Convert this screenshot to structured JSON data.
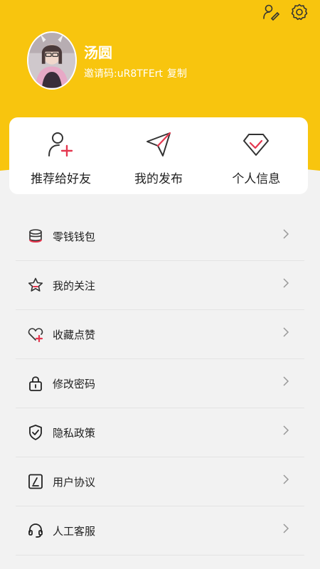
{
  "header": {
    "accent_color": "#f8c50e",
    "icons": [
      "user-edit-icon",
      "settings-gear-icon"
    ]
  },
  "profile": {
    "name": "汤圆",
    "invite_label": "邀请码:",
    "invite_code": "uR8TFErt",
    "copy_label": "复制"
  },
  "actions": [
    {
      "label": "推荐给好友",
      "icon": "add-user-icon"
    },
    {
      "label": "我的发布",
      "icon": "send-plane-icon"
    },
    {
      "label": "个人信息",
      "icon": "diamond-icon"
    }
  ],
  "menu": [
    {
      "label": "零钱钱包",
      "icon": "coins-icon"
    },
    {
      "label": "我的关注",
      "icon": "star-icon"
    },
    {
      "label": "收藏点赞",
      "icon": "heart-plus-icon"
    },
    {
      "label": "修改密码",
      "icon": "lock-icon"
    },
    {
      "label": "隐私政策",
      "icon": "shield-check-icon"
    },
    {
      "label": "用户协议",
      "icon": "document-sign-icon"
    },
    {
      "label": "人工客服",
      "icon": "headset-icon"
    }
  ]
}
